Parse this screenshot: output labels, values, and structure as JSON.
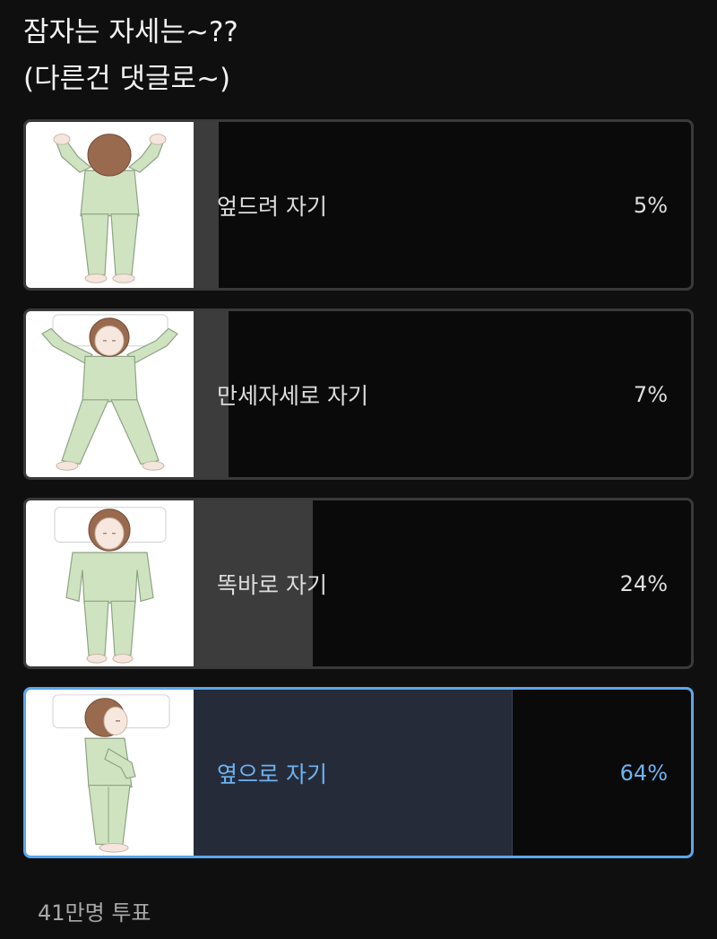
{
  "question": {
    "line1": "잠자는 자세는~??",
    "line2": "(다른건 댓글로~)"
  },
  "poll": {
    "options": [
      {
        "label": "엎드려 자기",
        "percent_label": "5%",
        "percent": 5,
        "selected": false,
        "image": "person-sleeping-prone-illustration"
      },
      {
        "label": "만세자세로 자기",
        "percent_label": "7%",
        "percent": 7,
        "selected": false,
        "image": "person-sleeping-arms-up-illustration"
      },
      {
        "label": "똑바로 자기",
        "percent_label": "24%",
        "percent": 24,
        "selected": false,
        "image": "person-sleeping-on-back-illustration"
      },
      {
        "label": "옆으로 자기",
        "percent_label": "64%",
        "percent": 64,
        "selected": true,
        "image": "person-sleeping-on-side-illustration"
      }
    ],
    "votes": "41만명 투표"
  },
  "colors": {
    "background": "#0f0f0f",
    "bar_fill": "#3c3c3c",
    "selected_fill": "#262b39",
    "selected_accent": "#5aa7ec",
    "pajama_green": "#cfe3c1",
    "hair_brown": "#9a6a4e"
  }
}
